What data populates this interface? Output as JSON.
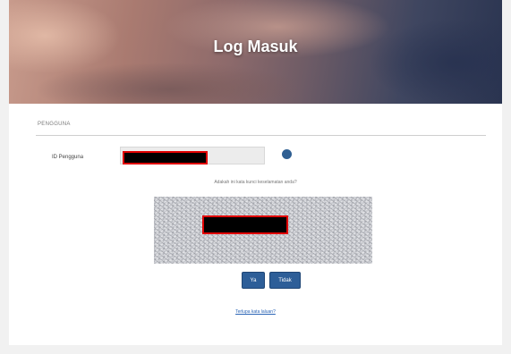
{
  "header": {
    "title": "Log Masuk"
  },
  "form": {
    "section_label": "PENGGUNA",
    "id_label": "ID Pengguna",
    "id_value": "",
    "captcha_prompt": "Adakah ini kata kunci keselamatan anda?",
    "ok_label": "Ya",
    "cancel_label": "Tidak",
    "forgot_link": "Terlupa kata laluan?"
  },
  "colors": {
    "button": "#2d5e98",
    "link": "#2a64b5",
    "info_icon": "#2f5f92",
    "redaction_border": "#e00000"
  }
}
